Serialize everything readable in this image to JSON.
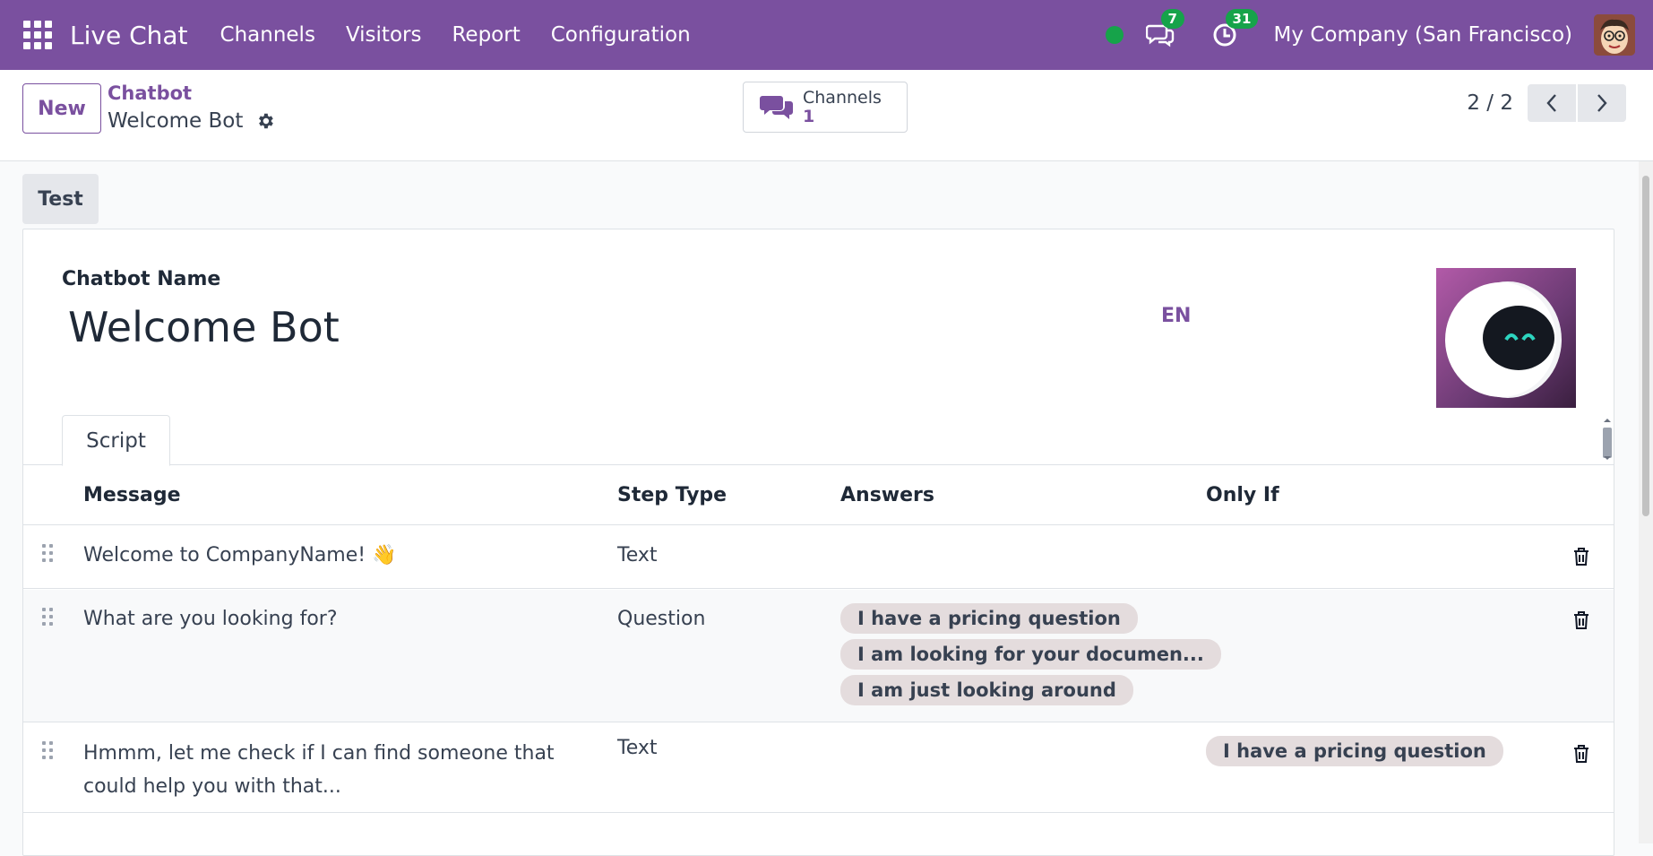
{
  "navbar": {
    "brand": "Live Chat",
    "menu": [
      "Channels",
      "Visitors",
      "Report",
      "Configuration"
    ],
    "messages_count": "7",
    "activities_count": "31",
    "company": "My Company (San Francisco)"
  },
  "control_panel": {
    "new_label": "New",
    "breadcrumb_parent": "Chatbot",
    "breadcrumb_current": "Welcome Bot",
    "smart_button": {
      "label": "Channels",
      "value": "1"
    },
    "pager": "2 / 2"
  },
  "form": {
    "test_label": "Test",
    "name_label": "Chatbot Name",
    "name_value": "Welcome Bot",
    "lang": "EN",
    "tab_script": "Script"
  },
  "table": {
    "headers": {
      "message": "Message",
      "step_type": "Step Type",
      "answers": "Answers",
      "only_if": "Only If"
    },
    "rows": [
      {
        "message": "Welcome to CompanyName! 👋",
        "step_type": "Text",
        "answers": [],
        "only_if": []
      },
      {
        "message": "What are you looking for?",
        "step_type": "Question",
        "answers": [
          "I have a pricing question",
          "I am looking for your documen...",
          "I am just looking around"
        ],
        "only_if": []
      },
      {
        "message": "Hmmm, let me check if I can find someone that could help you with that...",
        "step_type": "Text",
        "answers": [],
        "only_if": [
          "I have a pricing question"
        ]
      }
    ]
  },
  "colors": {
    "primary": "#7a509f",
    "presence": "#16a34a"
  }
}
